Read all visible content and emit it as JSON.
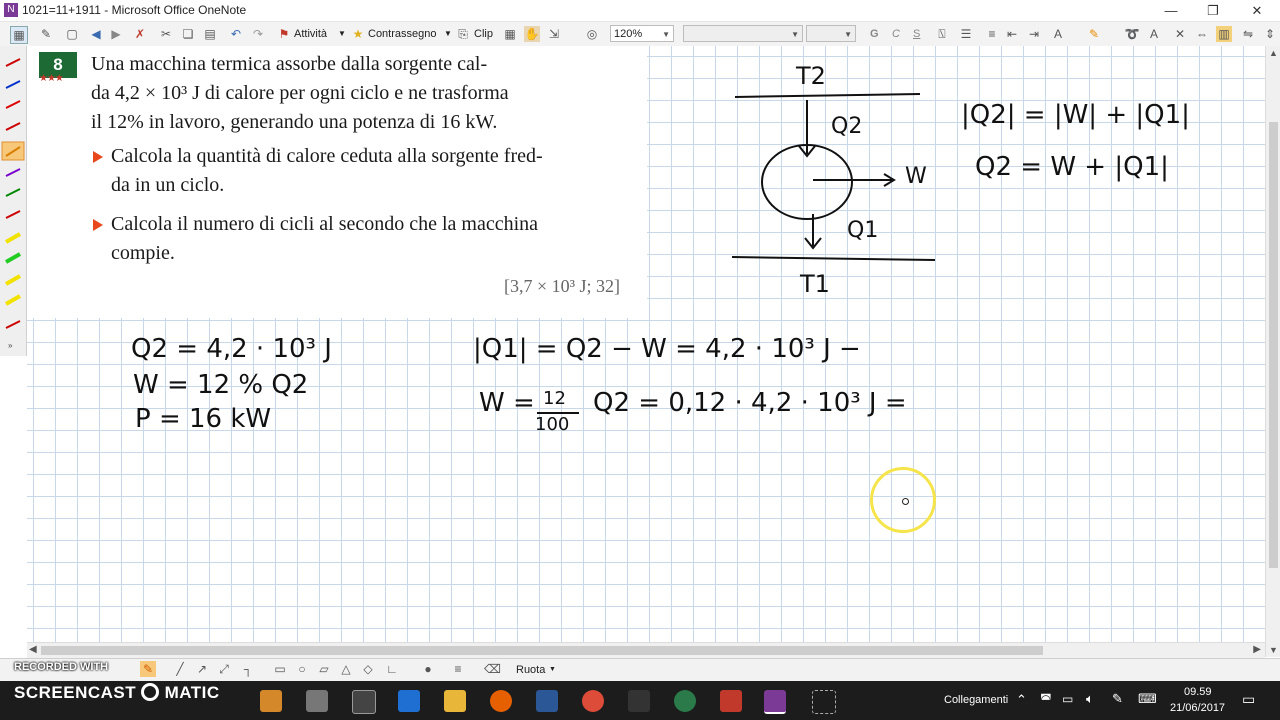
{
  "window": {
    "title": "1021=11+1911 - Microsoft Office OneNote"
  },
  "toolbar": {
    "activities_label": "Attività",
    "flag_label": "Contrassegno",
    "clip_label": "Clip",
    "zoom_value": "120%",
    "font_bold": "G",
    "font_italic": "C",
    "font_strike": "S"
  },
  "problem": {
    "number": "8",
    "stars": "★★★",
    "text_line1": "Una macchina termica assorbe dalla sorgente cal-",
    "text_line2": "da 4,2 × 10³ J di calore per ogni ciclo e ne trasforma",
    "text_line3": "il 12% in lavoro, generando una potenza di 16 kW.",
    "q1_line1": "Calcola la quantità di calore ceduta alla sorgente fred-",
    "q1_line2": "da in un ciclo.",
    "q2_line1": "Calcola il numero di cicli al secondo che la macchina",
    "q2_line2": "compie.",
    "answer": "[3,7 × 10³ J; 32]"
  },
  "handwriting": {
    "diagram_t2": "T2",
    "diagram_q2": "Q2",
    "diagram_w": "W",
    "diagram_q1": "Q1",
    "diagram_t1": "T1",
    "eq_abs": "|Q2| = |W| + |Q1|",
    "eq_plain": "Q2 = W + |Q1|",
    "given_q2": "Q2 = 4,2 · 10³ J",
    "given_w": "W = 12 % Q2",
    "given_p": "P = 16 kW",
    "calc_q1": "|Q1| = Q2 − W = 4,2 · 10³ J −",
    "calc_w_prefix": "W =",
    "calc_w_num": "12",
    "calc_w_den": "100",
    "calc_w_rest": "Q2 = 0,12 · 4,2 · 10³ J ="
  },
  "drawing_toolbar": {
    "rotate_label": "Ruota",
    "watermark": "RECORDED WITH",
    "brand": "SCREENCAST",
    "brand_suffix": "MATIC"
  },
  "taskbar": {
    "links_label": "Collegamenti",
    "time": "09.59",
    "date": "21/06/2017"
  },
  "colors": {
    "badge_green": "#1d6a35",
    "bullet_orange": "#e8471b",
    "grid_blue": "#c9d8e8",
    "cursor_yellow": "#f5e44a"
  }
}
